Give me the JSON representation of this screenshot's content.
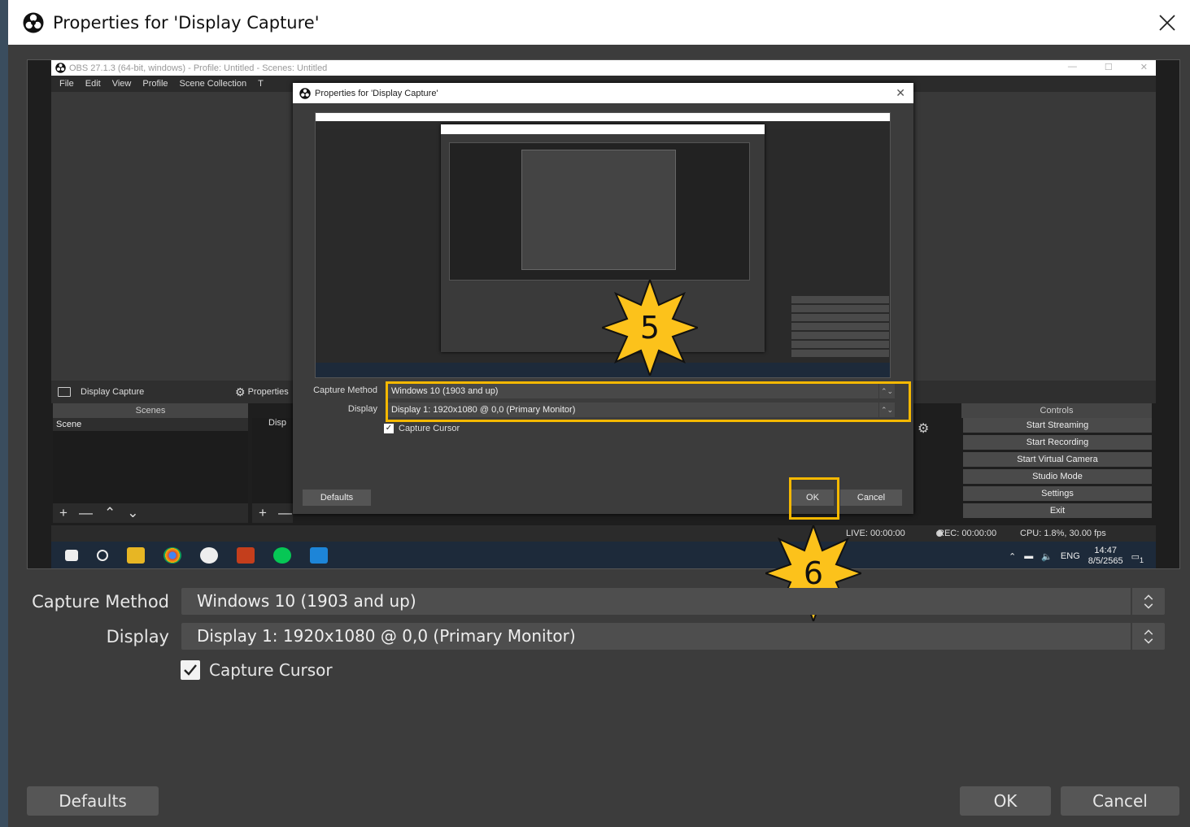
{
  "dialog": {
    "title": "Properties for 'Display Capture'",
    "close_icon": "close-icon"
  },
  "preview": {
    "obs_window_title": "OBS 27.1.3 (64-bit, windows) - Profile: Untitled - Scenes: Untitled",
    "menu": [
      "File",
      "Edit",
      "View",
      "Profile",
      "Scene Collection",
      "T"
    ],
    "source_name": "Display Capture",
    "properties_label": "Properties",
    "scenes_header": "Scenes",
    "scene_item": "Scene",
    "sources_item": "Disp",
    "controls_header": "Controls",
    "controls": [
      "Start Streaming",
      "Start Recording",
      "Start Virtual Camera",
      "Studio Mode",
      "Settings",
      "Exit"
    ],
    "status": {
      "live": "LIVE: 00:00:00",
      "rec": "REC: 00:00:00",
      "cpu": "CPU: 1.8%, 30.00 fps"
    },
    "tray": {
      "lang": "ENG",
      "time": "14:47",
      "date": "8/5/2565",
      "notification_count": "1"
    },
    "inner_dialog": {
      "title": "Properties for 'Display Capture'",
      "capture_method_label": "Capture Method",
      "capture_method_value": "Windows 10 (1903 and up)",
      "display_label": "Display",
      "display_value": "Display 1: 1920x1080 @ 0,0 (Primary Monitor)",
      "capture_cursor_label": "Capture Cursor",
      "defaults_label": "Defaults",
      "ok_label": "OK",
      "cancel_label": "Cancel"
    }
  },
  "annotations": {
    "step5": "5",
    "step6": "6",
    "accent_color": "#f5b800"
  },
  "form": {
    "capture_method_label": "Capture Method",
    "capture_method_value": "Windows 10 (1903 and up)",
    "display_label": "Display",
    "display_value": "Display 1: 1920x1080 @ 0,0 (Primary Monitor)",
    "capture_cursor_label": "Capture Cursor",
    "capture_cursor_checked": true
  },
  "buttons": {
    "defaults": "Defaults",
    "ok": "OK",
    "cancel": "Cancel"
  }
}
